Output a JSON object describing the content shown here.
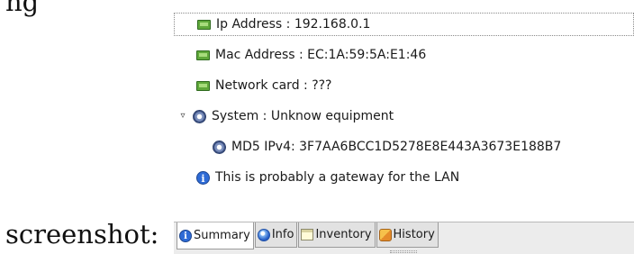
{
  "captions": {
    "top": "ng",
    "bottom": "screenshot:"
  },
  "tree": {
    "items": [
      {
        "icon": "network-card-icon",
        "label": "Ip Address : 192.168.0.1",
        "selected": true
      },
      {
        "icon": "network-card-icon",
        "label": "Mac Address : EC:1A:59:5A:E1:46"
      },
      {
        "icon": "network-card-icon",
        "label": "Network card : ???"
      },
      {
        "icon": "gear-icon",
        "label": "System : Unknow equipment",
        "expander": "▿"
      },
      {
        "icon": "gear-icon",
        "label": "MD5 IPv4: 3F7AA6BCC1D5278E8E443A3673E188B7"
      },
      {
        "icon": "info-icon",
        "label": "This is probably a gateway for the LAN"
      }
    ]
  },
  "tabs": [
    {
      "label": "Summary",
      "icon": "info-icon",
      "active": true
    },
    {
      "label": "Info",
      "icon": "globe-icon"
    },
    {
      "label": "Inventory",
      "icon": "document-icon"
    },
    {
      "label": "History",
      "icon": "history-icon"
    }
  ]
}
